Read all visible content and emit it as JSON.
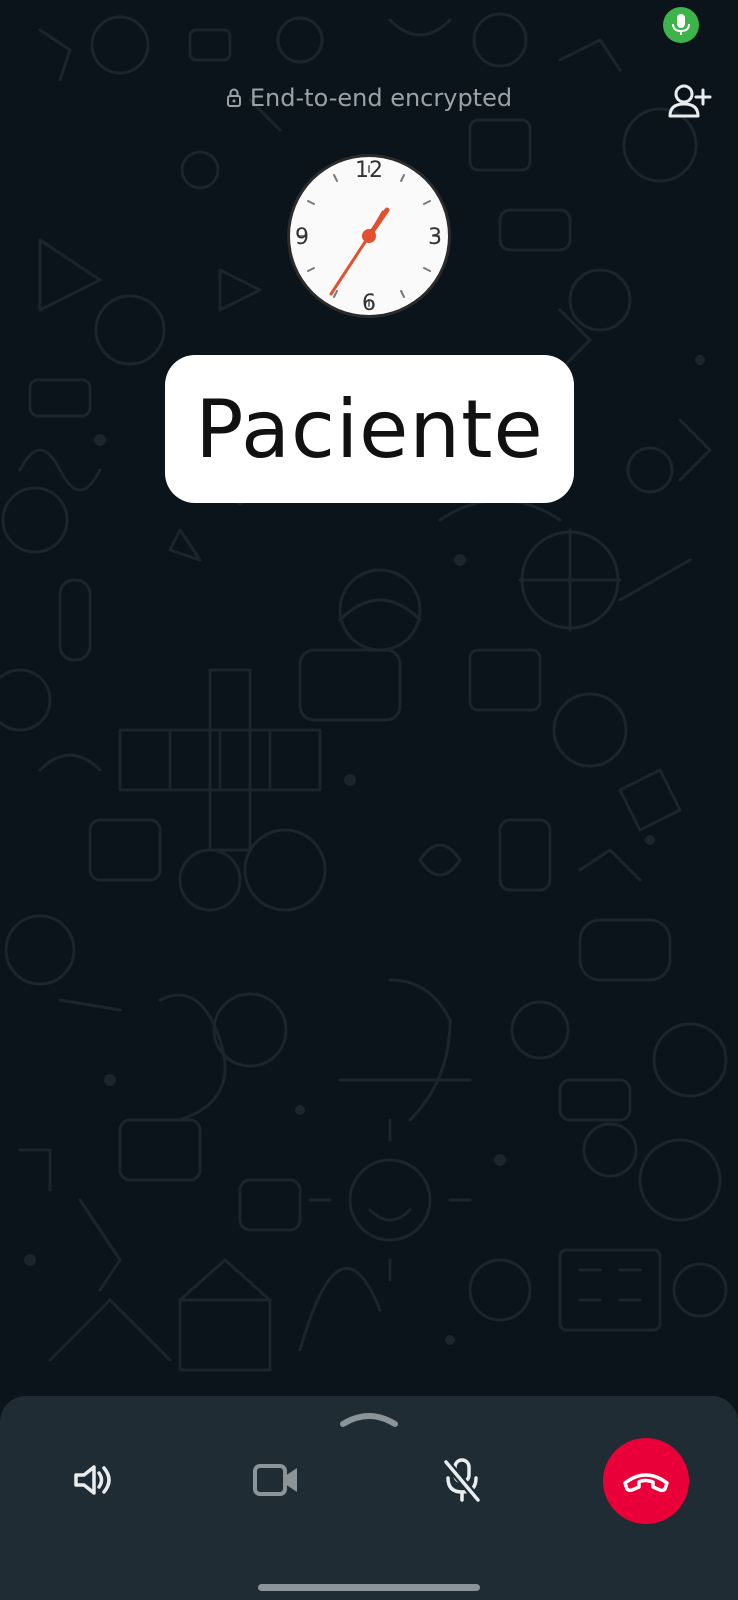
{
  "status": {
    "mic_indicator_icon": "microphone-icon",
    "mic_indicator_color": "#3cb44b"
  },
  "header": {
    "lock_icon": "lock-icon",
    "encryption_text": "End-to-end encrypted",
    "add_participant_icon": "add-person-icon"
  },
  "contact": {
    "avatar_icon": "clock-icon",
    "clock_numerals": [
      "12",
      "3",
      "6",
      "9"
    ],
    "name": "Paciente"
  },
  "call_controls": {
    "expand_icon": "chevron-up-icon",
    "speaker_icon": "speaker-icon",
    "video_icon": "video-off-icon",
    "mute_icon": "microphone-muted-icon",
    "end_call_icon": "end-call-icon",
    "end_call_color": "#ea0038"
  },
  "theme": {
    "background": "#0b141a",
    "panel": "#1f2c34",
    "text_muted": "#9aa2a7"
  }
}
